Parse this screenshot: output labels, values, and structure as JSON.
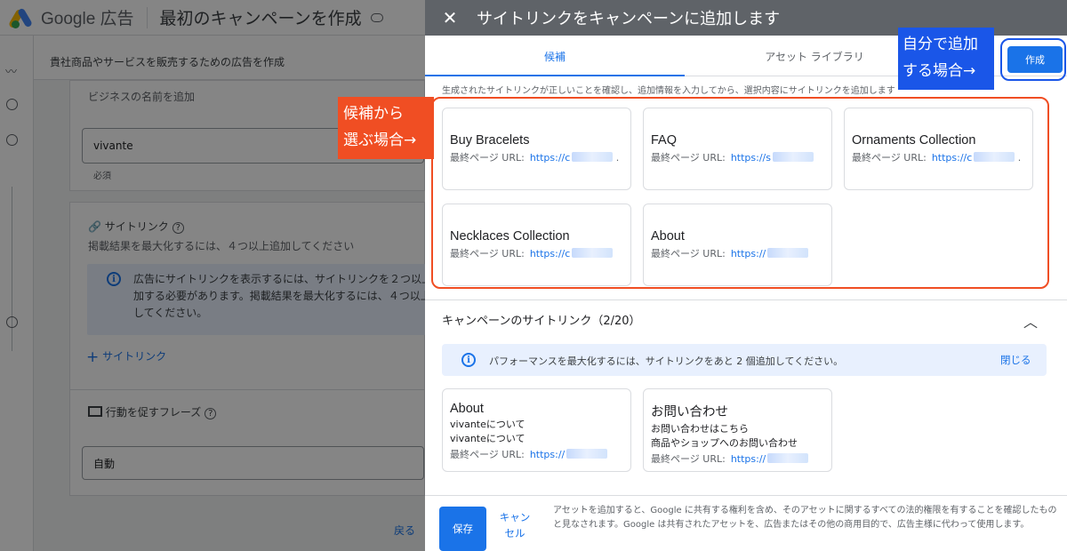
{
  "background": {
    "brand": "Google 広告",
    "page_title": "最初のキャンペーンを作成",
    "subheader": "貴社商品やサービスを販売するための広告を作成",
    "business_name_label": "ビジネスの名前を追加",
    "business_name_value": "vivante",
    "required_label": "必須",
    "sitelink_title": "サイトリンク",
    "sitelink_desc": "掲載結果を最大化するには、４つ以上追加してください",
    "sitelink_info": [
      "広告にサイトリンクを表示するには、サイトリンクを２つ以上",
      "加する必要があります。掲載結果を最大化するには、４つ以上",
      "してください。"
    ],
    "add_sitelink": "サイトリンク",
    "cta_title": "行動を促すフレーズ",
    "cta_value": "自動",
    "back_link": "戻る"
  },
  "panel": {
    "title": "サイトリンクをキャンペーンに追加します",
    "close_icon": "close-icon",
    "tabs": [
      {
        "label": "候補",
        "active": true
      },
      {
        "label": "アセット ライブラリ",
        "active": false
      }
    ],
    "create_button": "作成",
    "instruction": "生成されたサイトリンクが正しいことを確認し、追加情報を入力してから、選択内容にサイトリンクを追加します",
    "url_label": "最終ページ URL:",
    "suggestions": [
      {
        "title": "Buy Bracelets",
        "url": "https://c"
      },
      {
        "title": "FAQ",
        "url": "https://s"
      },
      {
        "title": "Ornaments Collection",
        "url": "https://c"
      },
      {
        "title": "Necklaces Collection",
        "url": "https://c"
      },
      {
        "title": "About",
        "url": "https://"
      }
    ],
    "campaign_section_title": "キャンペーンのサイトリンク（2/20）",
    "performance_banner": "パフォーマンスを最大化するには、サイトリンクをあと 2 個追加してください。",
    "banner_close": "閉じる",
    "campaign_sitelinks": [
      {
        "title": "About",
        "desc1": "vivanteについて",
        "desc2": "vivanteについて",
        "url": "https://"
      },
      {
        "title": "お問い合わせ",
        "desc1": "お問い合わせはこちら",
        "desc2": "商品やショップへのお問い合わせ",
        "url": "https://"
      }
    ],
    "save_button": "保存",
    "cancel_button": "キャンセル",
    "legal_text": "アセットを追加すると、Google に共有する権利を含め、そのアセットに関するすべての法的権限を有することを確認したものと見なされます。Google は共有されたアセットを、広告またはその他の商用目的で、広告主様に代わって使用します。"
  },
  "annotations": {
    "red_note_line1": "候補から",
    "red_note_line2": "選ぶ場合→",
    "blue_note_line1": "自分で追加",
    "blue_note_line2": "する場合→",
    "red_color": "#f04e23",
    "blue_color": "#1a56e8"
  }
}
